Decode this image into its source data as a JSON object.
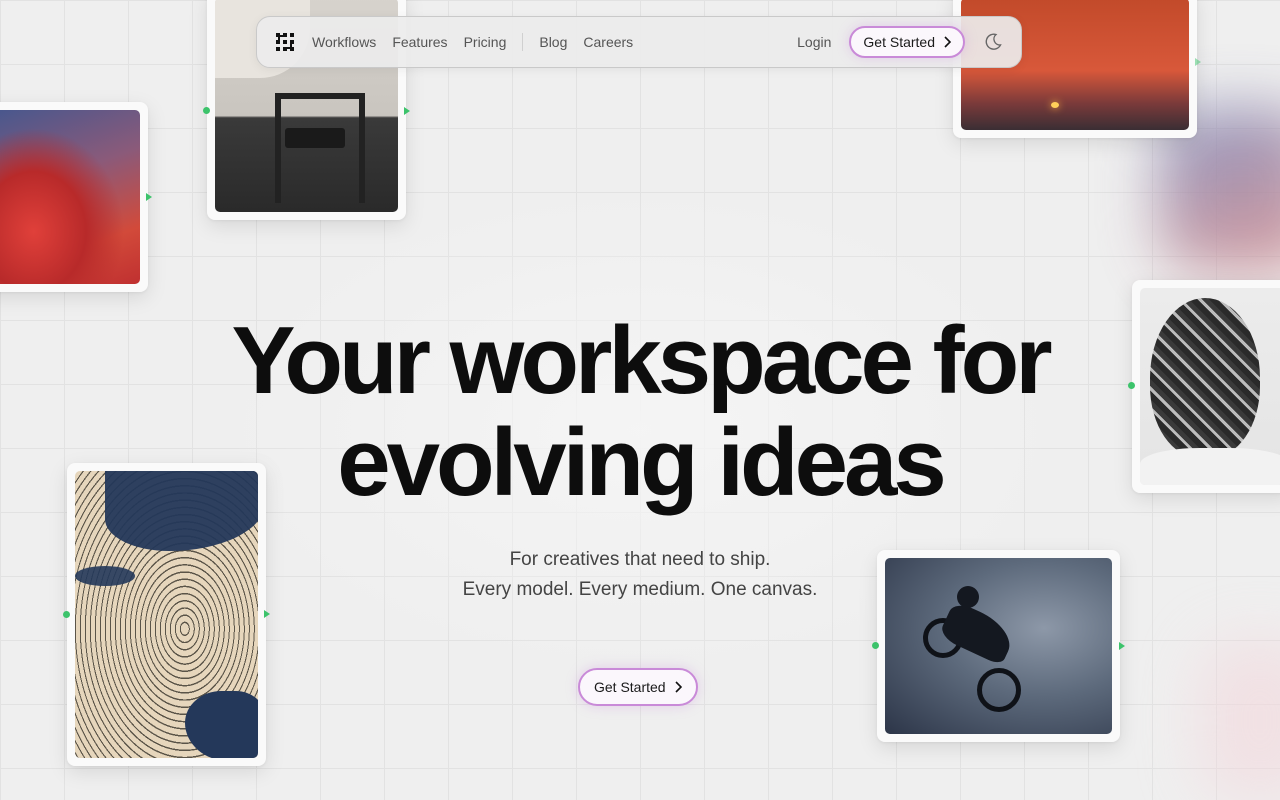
{
  "nav": {
    "logo_icon": "pixel-square-logo",
    "links": [
      "Workflows",
      "Features",
      "Pricing"
    ],
    "links_secondary": [
      "Blog",
      "Careers"
    ],
    "login": "Login",
    "cta": "Get Started",
    "theme_icon": "moon-icon"
  },
  "hero": {
    "title_line1": "Your workspace for",
    "title_line2": "evolving ideas",
    "subtitle_line1": "For creatives that need to ship.",
    "subtitle_line2": "Every model. Every medium. One canvas.",
    "cta": "Get Started"
  },
  "colors": {
    "accent_border": "#c98ad8",
    "node_green": "#3cc36b",
    "background": "#efefef"
  }
}
